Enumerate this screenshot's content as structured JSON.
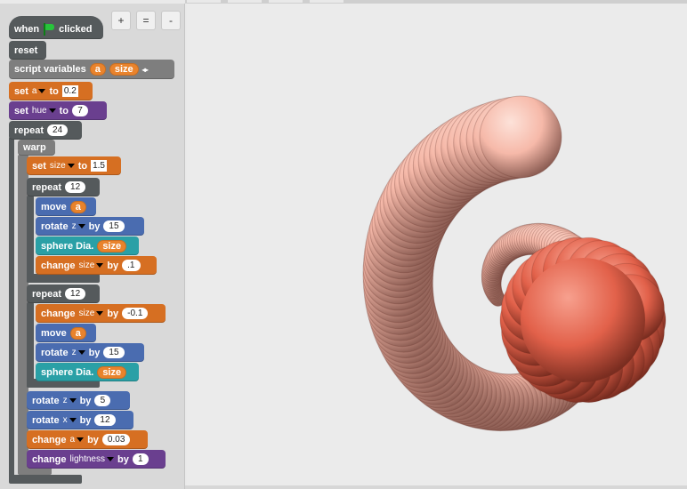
{
  "toolbar": {
    "zoom_in_label": "+",
    "zoom_reset_label": "=",
    "zoom_out_label": "-"
  },
  "blocks": {
    "hat": {
      "prefix": "when",
      "suffix": "clicked"
    },
    "reset": {
      "label": "reset"
    },
    "script_vars": {
      "label": "script variables",
      "var1": "a",
      "var2": "size",
      "arrows": "◂▸"
    },
    "set_a": {
      "label": "set",
      "var": "a",
      "to": "to",
      "value": "0.2"
    },
    "set_hue": {
      "label": "set",
      "prop": "hue",
      "to": "to",
      "value": "7"
    },
    "repeat_outer": {
      "label": "repeat",
      "value": "24"
    },
    "warp": {
      "label": "warp"
    },
    "set_size": {
      "label": "set",
      "var": "size",
      "to": "to",
      "value": "1.5"
    },
    "repeat1": {
      "label": "repeat",
      "value": "12"
    },
    "move1": {
      "label": "move",
      "var": "a"
    },
    "rotate1": {
      "label": "rotate",
      "axis": "z",
      "by": "by",
      "value": "15"
    },
    "sphere1": {
      "label": "sphere Dia.",
      "var": "size"
    },
    "change1": {
      "label": "change",
      "var": "size",
      "by": "by",
      "value": ".1"
    },
    "repeat2": {
      "label": "repeat",
      "value": "12"
    },
    "change2": {
      "label": "change",
      "var": "size",
      "by": "by",
      "value": "-0.1"
    },
    "move2": {
      "label": "move",
      "var": "a"
    },
    "rotate2": {
      "label": "rotate",
      "axis": "z",
      "by": "by",
      "value": "15"
    },
    "sphere2": {
      "label": "sphere Dia.",
      "var": "size"
    },
    "rotate3": {
      "label": "rotate",
      "axis": "z",
      "by": "by",
      "value": "5"
    },
    "rotate4": {
      "label": "rotate",
      "axis": "x",
      "by": "by",
      "value": "12"
    },
    "change_a": {
      "label": "change",
      "var": "a",
      "by": "by",
      "value": "0.03"
    },
    "change_light": {
      "label": "change",
      "prop": "lightness",
      "by": "by",
      "value": "1"
    }
  },
  "stage": {
    "shape": "spiral-shell-of-spheres",
    "color_light": "#f6b9a9",
    "color_dark": "#e2614a"
  }
}
